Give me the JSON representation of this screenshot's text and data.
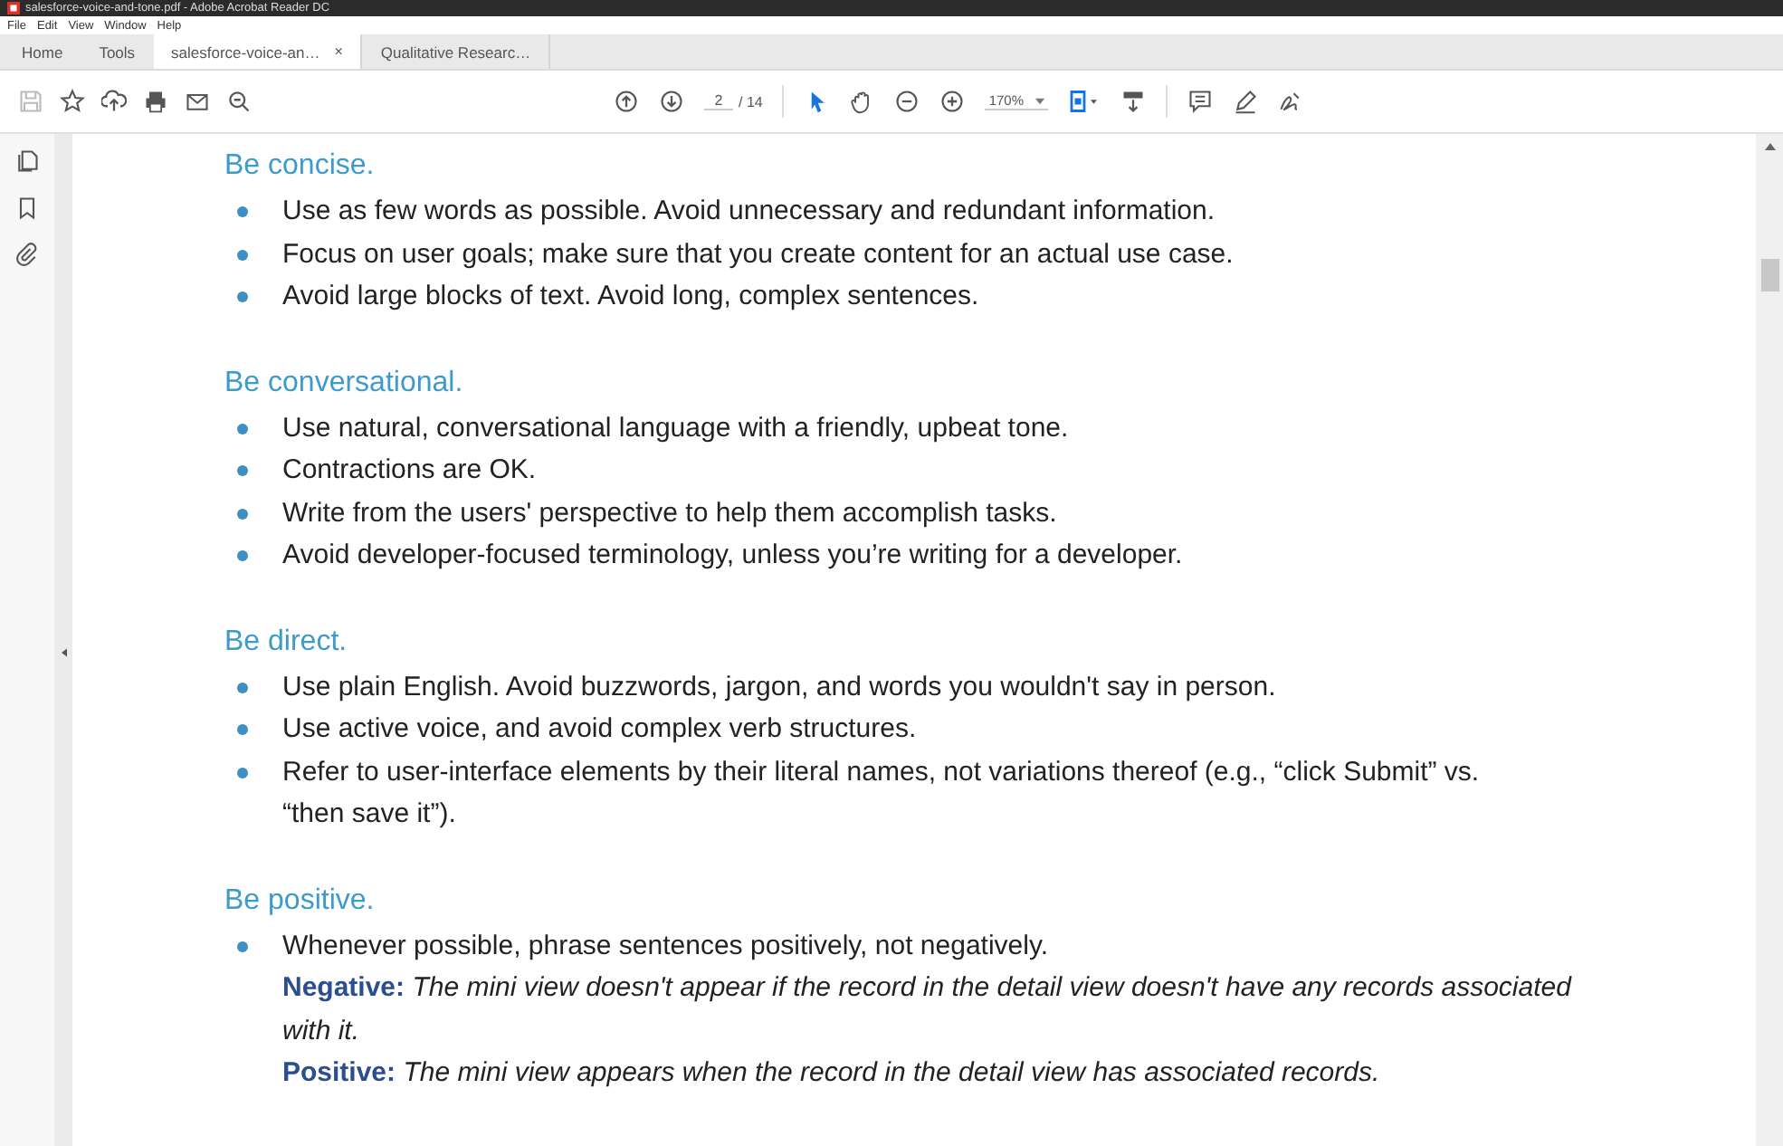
{
  "window": {
    "title": "salesforce-voice-and-tone.pdf - Adobe Acrobat Reader DC"
  },
  "menu": [
    "File",
    "Edit",
    "View",
    "Window",
    "Help"
  ],
  "tabs": [
    {
      "label": "Home",
      "selected": false,
      "closable": false
    },
    {
      "label": "Tools",
      "selected": false,
      "closable": false
    },
    {
      "label": "salesforce-voice-an…",
      "selected": true,
      "closable": true,
      "close": "×"
    },
    {
      "label": "Qualitative Researc…",
      "selected": false,
      "closable": false
    }
  ],
  "toolbar": {
    "page": "2",
    "page_total": "/ 14",
    "zoom": "170%"
  },
  "sections": [
    {
      "heading": "Be concise.",
      "items": [
        {
          "kind": "bullet",
          "text": "Use as few words as possible. Avoid unnecessary and redundant information."
        },
        {
          "kind": "bullet",
          "text": "Focus on user goals; make sure that you create content for an actual use case."
        },
        {
          "kind": "bullet",
          "text": "Avoid large blocks of text. Avoid long, complex sentences."
        }
      ]
    },
    {
      "heading": "Be conversational.",
      "items": [
        {
          "kind": "bullet",
          "text": "Use natural, conversational language with a friendly, upbeat tone."
        },
        {
          "kind": "bullet",
          "text": "Contractions are OK."
        },
        {
          "kind": "bullet",
          "text": "Write from the users' perspective to help them accomplish tasks."
        },
        {
          "kind": "bullet",
          "text": "Avoid developer-focused terminology, unless you’re writing for a developer."
        }
      ]
    },
    {
      "heading": "Be direct.",
      "items": [
        {
          "kind": "bullet",
          "text": "Use plain English. Avoid buzzwords, jargon, and words you wouldn't say in person."
        },
        {
          "kind": "bullet",
          "text": "Use active voice, and avoid complex verb structures."
        },
        {
          "kind": "bullet",
          "text": "Refer to user-interface elements by their literal names, not variations thereof (e.g., “click Submit” vs. “then save it”)."
        }
      ]
    },
    {
      "heading": "Be positive.",
      "items": [
        {
          "kind": "bullet",
          "text": "Whenever possible, phrase sentences positively, not negatively."
        },
        {
          "kind": "example",
          "label": "Negative:",
          "text": "The mini view doesn't appear if the record in the detail view doesn't have any records associated with it."
        },
        {
          "kind": "example",
          "label": "Positive:",
          "text": "The mini view appears when the record in the detail view has associated records."
        }
      ]
    }
  ]
}
